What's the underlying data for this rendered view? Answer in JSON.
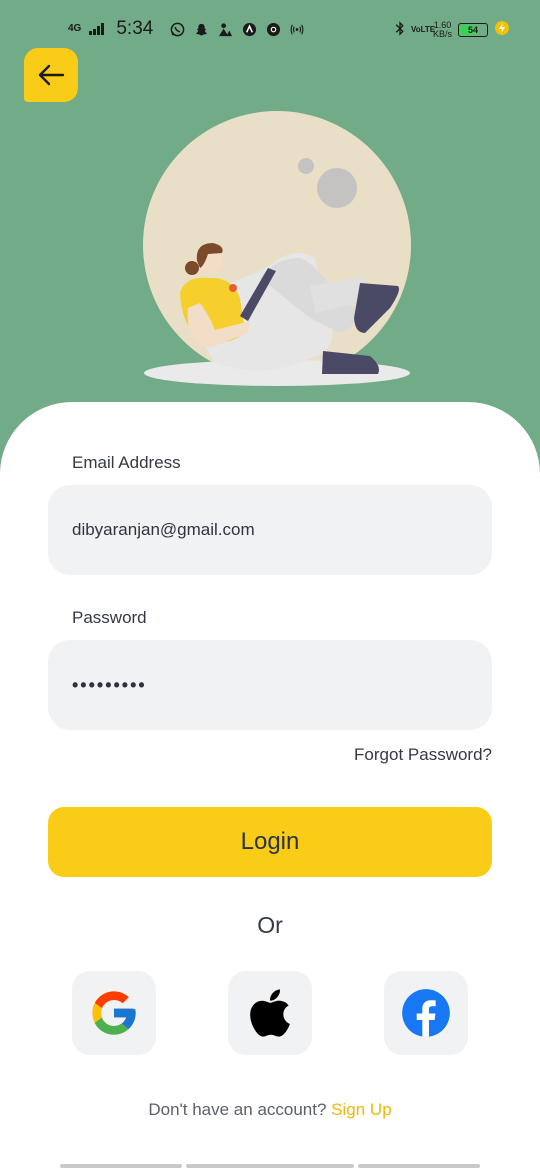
{
  "status_bar": {
    "network": "4G",
    "time": "5:34",
    "notifications": [
      "whatsapp-icon",
      "snapchat-icon",
      "app-icon",
      "arc-icon",
      "chrome-icon",
      "hotspot-icon"
    ],
    "volte": "VoLTE",
    "speed_value": "1.60",
    "speed_unit": "KB/s",
    "battery": "54"
  },
  "colors": {
    "background": "#72ab87",
    "accent": "#f9cc18",
    "link": "#f2b705",
    "field_bg": "#f1f2f4"
  },
  "form": {
    "email_label": "Email Address",
    "email_value": "dibyaranjan@gmail.com",
    "password_label": "Password",
    "password_value": "•••••••••",
    "forgot_label": "Forgot Password?",
    "login_label": "Login",
    "or_label": "Or"
  },
  "social": [
    "google-icon",
    "apple-icon",
    "facebook-icon"
  ],
  "footer": {
    "prompt": "Don't have an account?",
    "signup_label": "Sign Up"
  }
}
